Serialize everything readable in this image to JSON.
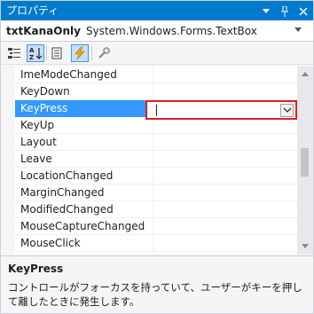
{
  "window": {
    "title": "プロパティ",
    "colors": {
      "accent": "#007acc",
      "selection": "#3399ff",
      "highlight_border": "#e21f26"
    }
  },
  "object_selector": {
    "name": "txtKanaOnly",
    "type": "System.Windows.Forms.TextBox"
  },
  "toolbar": {
    "buttons": [
      {
        "icon": "categorized-icon",
        "active": false
      },
      {
        "icon": "alphabetical-icon",
        "active": true
      },
      {
        "icon": "properties-icon",
        "active": false
      },
      {
        "icon": "events-icon",
        "active": true
      },
      {
        "icon": "property-pages-icon",
        "active": false
      }
    ]
  },
  "grid": {
    "rows": [
      {
        "name": "ImeModeChanged",
        "value": ""
      },
      {
        "name": "KeyDown",
        "value": ""
      },
      {
        "name": "KeyPress",
        "value": "",
        "selected": true
      },
      {
        "name": "KeyUp",
        "value": ""
      },
      {
        "name": "Layout",
        "value": ""
      },
      {
        "name": "Leave",
        "value": ""
      },
      {
        "name": "LocationChanged",
        "value": ""
      },
      {
        "name": "MarginChanged",
        "value": ""
      },
      {
        "name": "ModifiedChanged",
        "value": ""
      },
      {
        "name": "MouseCaptureChanged",
        "value": ""
      },
      {
        "name": "MouseClick",
        "value": ""
      }
    ]
  },
  "description": {
    "title": "KeyPress",
    "text": "コントロールがフォーカスを持っていて、ユーザーがキーを押して離したときに発生します。"
  }
}
